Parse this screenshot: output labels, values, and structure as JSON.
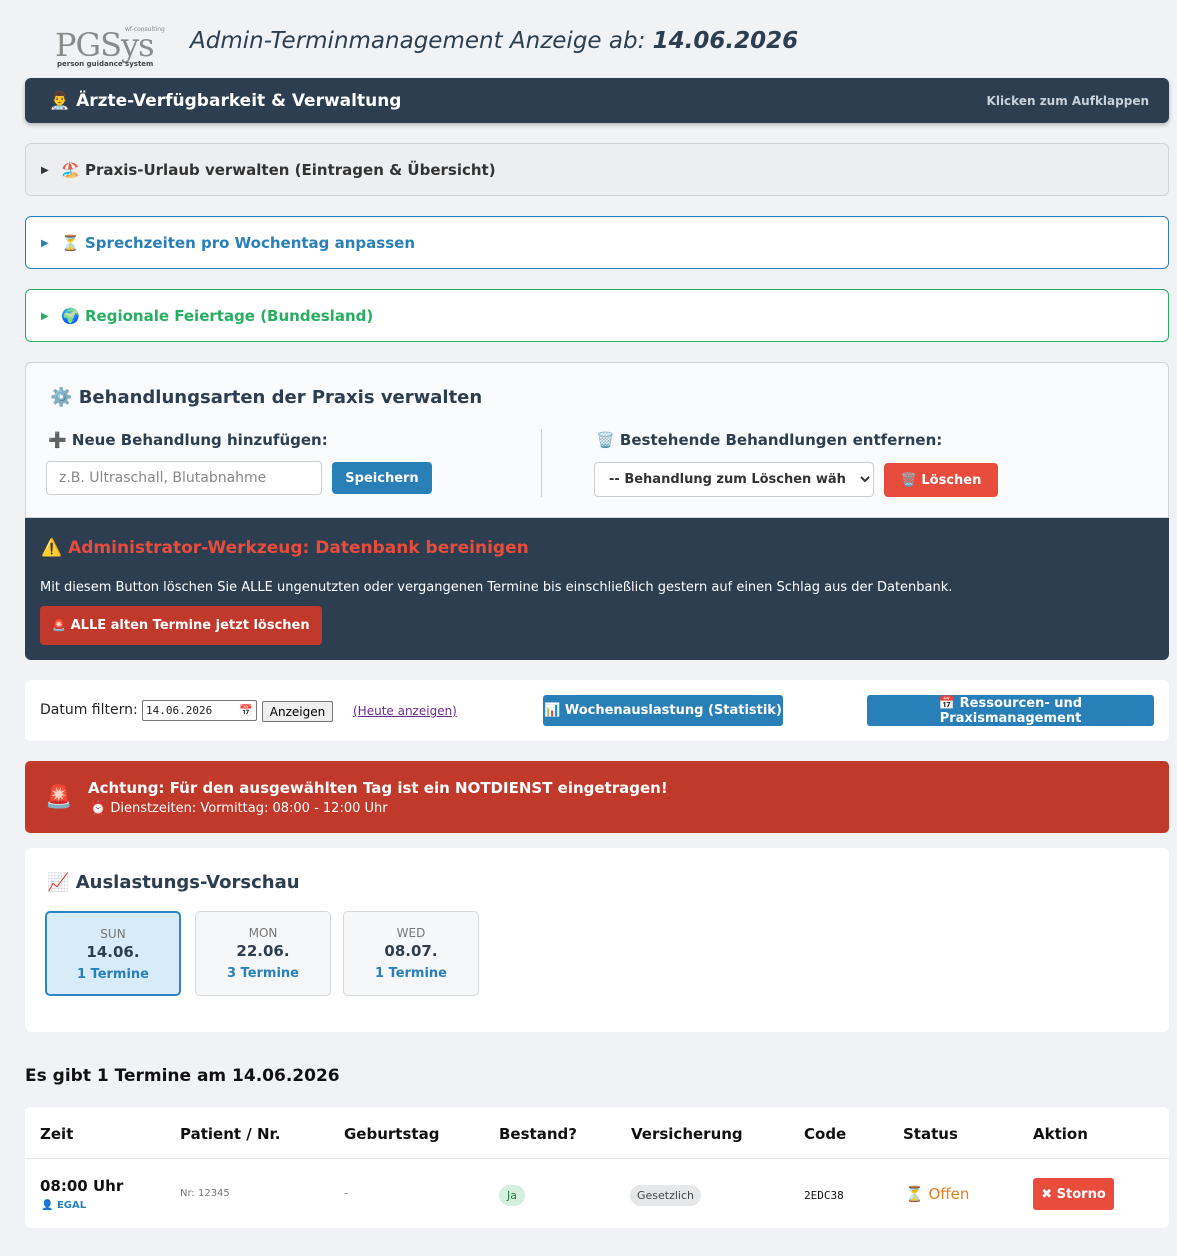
{
  "header": {
    "logo": {
      "main": "PGSys",
      "tagline": "person guidance system",
      "small": "wf-consulting"
    },
    "title": "Admin-Terminmanagement  Anzeige ab:",
    "title_date": "14.06.2026"
  },
  "doctors_bar": {
    "icon": "👨‍⚕️",
    "label": "Ärzte-Verfügbarkeit & Verwaltung",
    "hint": "Klicken zum Aufklappen"
  },
  "accordions": [
    {
      "icon": "🏖️",
      "label": "Praxis-Urlaub verwalten (Eintragen & Übersicht)"
    },
    {
      "icon": "⏳",
      "label": "Sprechzeiten pro Wochentag anpassen"
    },
    {
      "icon": "🌍",
      "label": "Regionale Feiertage (Bundesland)"
    }
  ],
  "treatments": {
    "title": "Behandlungsarten der Praxis verwalten",
    "add_label": "Neue Behandlung hinzufügen:",
    "input_placeholder": "z.B. Ultraschall, Blutabnahme",
    "save_button": "Speichern",
    "remove_label": "Bestehende Behandlungen entfernen:",
    "select_value": "-- Behandlung zum Löschen wählen --",
    "delete_button": "Löschen"
  },
  "admin_tool": {
    "title": "Administrator-Werkzeug: Datenbank bereinigen",
    "description": "Mit diesem Button löschen Sie ALLE ungenutzten oder vergangenen Termine bis einschließlich gestern auf einen Schlag aus der Datenbank.",
    "button": "ALLE alten Termine jetzt löschen"
  },
  "filter": {
    "label": "Datum filtern:",
    "date_value": "14.06.2026",
    "show_button": "Anzeigen",
    "today_link": "(Heute anzeigen)",
    "stats_button": "Wochenauslastung (Statistik)",
    "resources_button": "Ressourcen- und Praxismanagement"
  },
  "alert": {
    "title": "Achtung: Für den ausgewählten Tag ist ein NOTDIENST eingetragen!",
    "hours": "Dienstzeiten: Vormittag: 08:00 - 12:00 Uhr"
  },
  "preview": {
    "title": "Auslastungs-Vorschau",
    "days": [
      {
        "weekday": "SUN",
        "date": "14.06.",
        "count": "1 Termine",
        "active": true
      },
      {
        "weekday": "MON",
        "date": "22.06.",
        "count": "3 Termine",
        "active": false
      },
      {
        "weekday": "WED",
        "date": "08.07.",
        "count": "1 Termine",
        "active": false
      }
    ]
  },
  "appointments": {
    "summary": "Es gibt 1 Termine am 14.06.2026",
    "headers": [
      "Zeit",
      "Patient / Nr.",
      "Geburtstag",
      "Bestand?",
      "Versicherung",
      "Code",
      "Status",
      "Aktion"
    ],
    "rows": [
      {
        "time": "08:00 Uhr",
        "doctor": "EGAL",
        "patient_nr": "Nr: 12345",
        "birthday": "-",
        "existing": "Ja",
        "insurance": "Gesetzlich",
        "code": "2EDC38",
        "status": "Offen",
        "action": "Storno"
      }
    ]
  },
  "colors": {
    "navy": "#2c3e50",
    "blue": "#2980b9",
    "green": "#27ae60",
    "red": "#c0392b",
    "alert_red": "#e74c3c",
    "orange": "#e67e22"
  }
}
